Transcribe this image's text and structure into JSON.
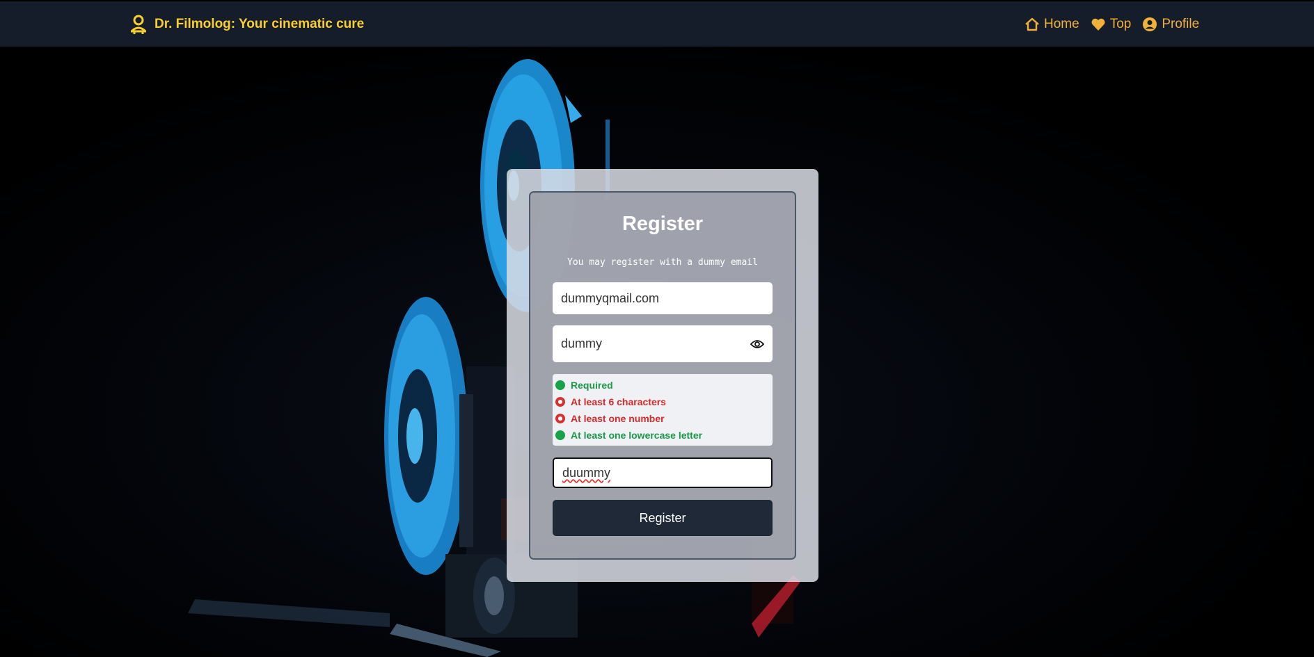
{
  "header": {
    "brand_icon": "user-pin-icon",
    "brand_title": "Dr. Filmolog: Your cinematic cure",
    "nav": [
      {
        "label": "Home",
        "icon": "home-icon"
      },
      {
        "label": "Top",
        "icon": "heart-icon"
      },
      {
        "label": "Profile",
        "icon": "user-circle-icon"
      }
    ],
    "colors": {
      "bar": "#151c2a",
      "brand": "#f9cf2f",
      "nav": "#f0b13a"
    }
  },
  "form": {
    "title": "Register",
    "subtitle": "You may register with a dummy email",
    "email_value": "dummyqmail.com",
    "password_value": "dummy",
    "password_toggle_icon": "eye-icon",
    "rules": [
      {
        "label": "Required",
        "status": "ok"
      },
      {
        "label": "At least 6 characters",
        "status": "fail"
      },
      {
        "label": "At least one number",
        "status": "fail"
      },
      {
        "label": "At least one lowercase letter",
        "status": "ok"
      }
    ],
    "confirm_value": "duummy",
    "submit_label": "Register",
    "colors": {
      "ok": "#18a34a",
      "fail": "#d73232",
      "button": "#1f2937"
    }
  }
}
